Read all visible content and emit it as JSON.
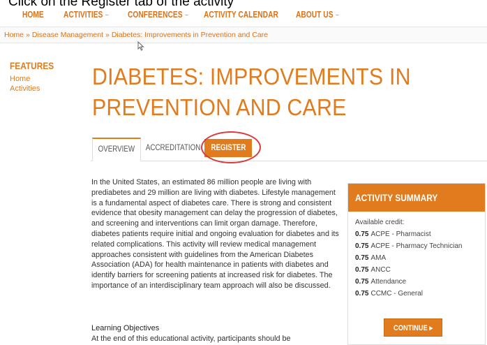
{
  "instruction": "Click on the Register tab of the activity",
  "nav": {
    "home": "HOME",
    "activities": "ACTIVITIES",
    "conferences": "CONFERENCES",
    "calendar": "ACTIVITY CALENDAR",
    "about": "ABOUT US",
    "caret": "−"
  },
  "breadcrumb": {
    "home": "Home",
    "category": "Disease Management",
    "current": "Diabetes: Improvements in Prevention and Care",
    "sep": "»"
  },
  "sidebar": {
    "heading": "FEATURES",
    "link1": "Home",
    "link2": "Activities"
  },
  "page": {
    "title": "DIABETES: IMPROVEMENTS IN PREVENTION AND CARE"
  },
  "tabs": {
    "overview": "OVERVIEW",
    "accreditation": "ACCREDITATION",
    "register": "REGISTER"
  },
  "overview": {
    "body": "In the United States, an estimated 86 million people are living with prediabetes and 29 million are living with diabetes. Lifestyle management is a fundamental aspect of diabetes care. There is strong and consistent evidence that obesity management can delay the progression of diabetes, and screening and interventions can limit organ damage. Therefore, diabetes patients require initial and ongoing evaluation for diabetes and its related complications. This activity will review medical management approaches consistent with guidelines from the American Diabetes Association (ADA) for health maintenance in patients with diabetes and identify barriers for screening patients at increased risk for diabetes. The importance of an interdisciplinary team approach will also be discussed.",
    "lo_heading": "Learning Objectives",
    "lo_text": "At the end of this educational activity, participants should be"
  },
  "summary": {
    "heading": "ACTIVITY SUMMARY",
    "credit_label": "Available credit:",
    "credits": [
      {
        "value": "0.75",
        "label": "ACPE - Pharmacist"
      },
      {
        "value": "0.75",
        "label": "ACPE - Pharmacy Technician"
      },
      {
        "value": "0.75",
        "label": "AMA"
      },
      {
        "value": "0.75",
        "label": "ANCC"
      },
      {
        "value": "0.75",
        "label": "Attendance"
      },
      {
        "value": "0.75",
        "label": "CCMC - General"
      }
    ],
    "continue": "CONTINUE ▸"
  },
  "colors": {
    "accent": "#e07b1e",
    "highlight": "#d93a3a"
  }
}
